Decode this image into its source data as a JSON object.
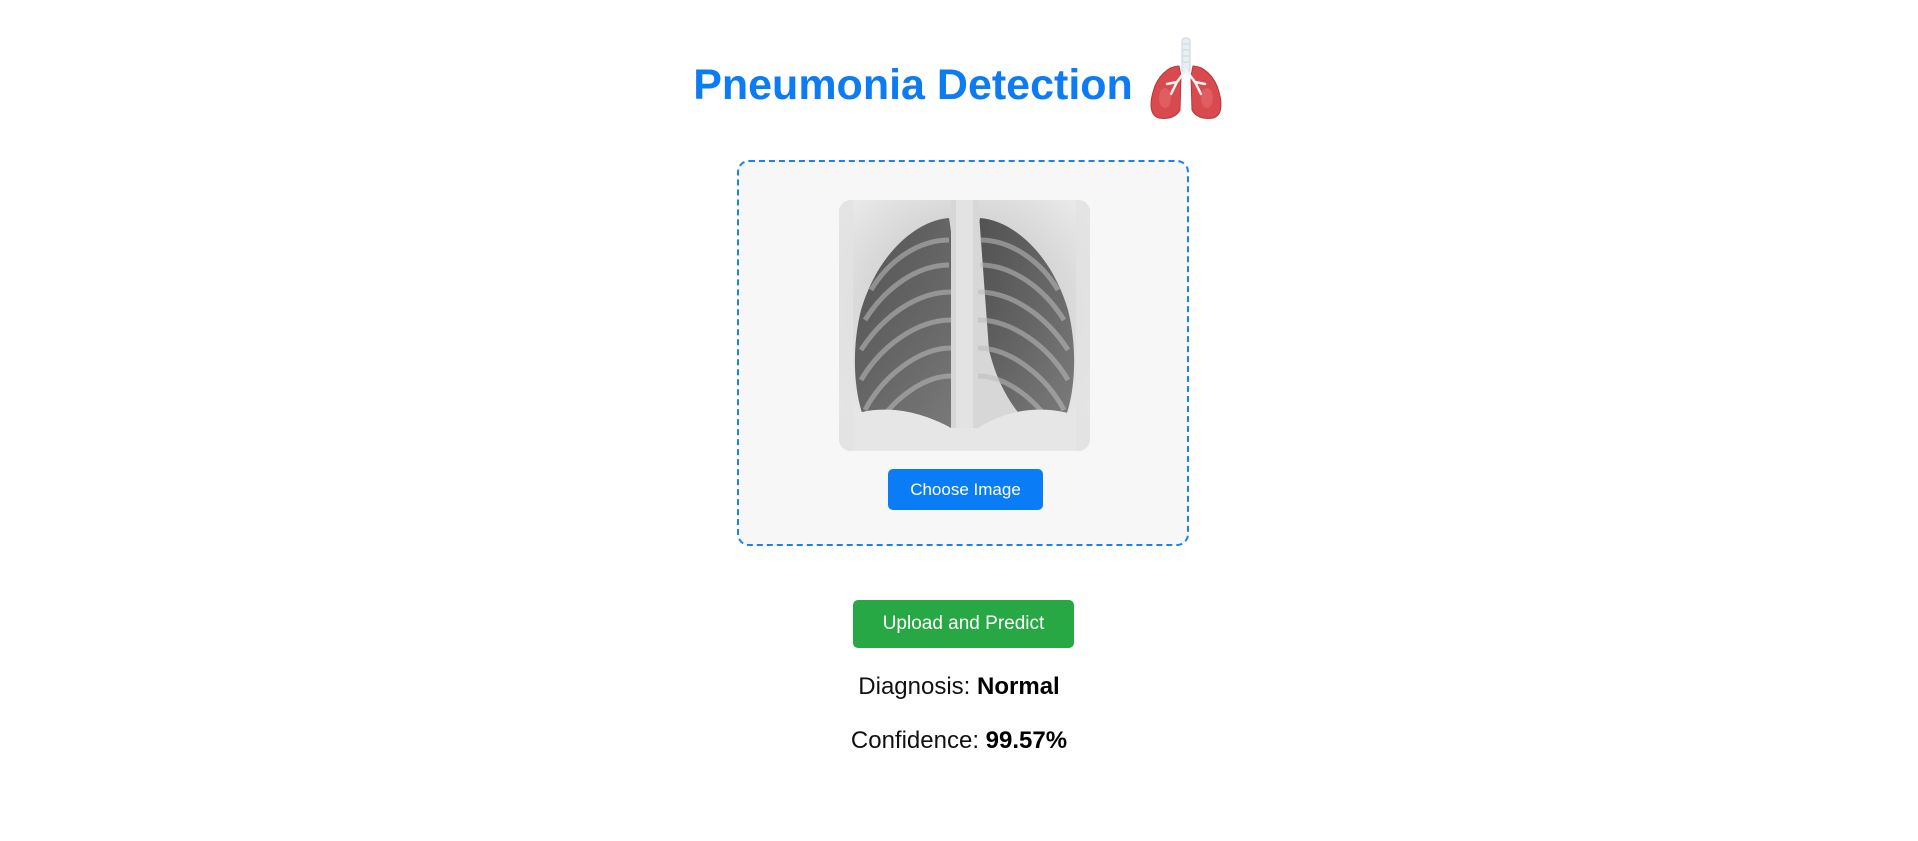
{
  "header": {
    "title": "Pneumonia Detection",
    "icon": "lungs-icon"
  },
  "upload": {
    "preview_image": "chest-xray-image",
    "choose_label": "Choose Image"
  },
  "actions": {
    "predict_label": "Upload and Predict"
  },
  "result": {
    "diagnosis_label": "Diagnosis:",
    "diagnosis_value": "Normal",
    "confidence_label": "Confidence:",
    "confidence_value": "99.57%"
  },
  "colors": {
    "title": "#0d7bf2",
    "choose_button": "#0a7cf5",
    "predict_button": "#28a745",
    "upload_border": "#1a82f0"
  }
}
